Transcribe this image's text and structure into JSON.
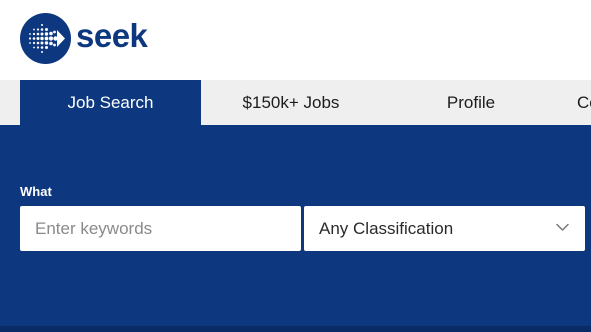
{
  "header": {
    "logo_text": "seek"
  },
  "tabs": [
    {
      "label": "Job Search",
      "active": true
    },
    {
      "label": "$150k+ Jobs",
      "active": false
    },
    {
      "label": "Profile",
      "active": false
    },
    {
      "label": "Co",
      "active": false
    }
  ],
  "search": {
    "what_label": "What",
    "keywords_placeholder": "Enter keywords",
    "keywords_value": "",
    "classification_value": "Any Classification"
  },
  "colors": {
    "brand_blue": "#0d3880",
    "tab_bar_bg": "#efefef",
    "page_bg": "#ffffff"
  },
  "icons": {
    "logo": "seek-logo-dot-arrow-icon",
    "select_indicator": "chevron-down-icon"
  }
}
